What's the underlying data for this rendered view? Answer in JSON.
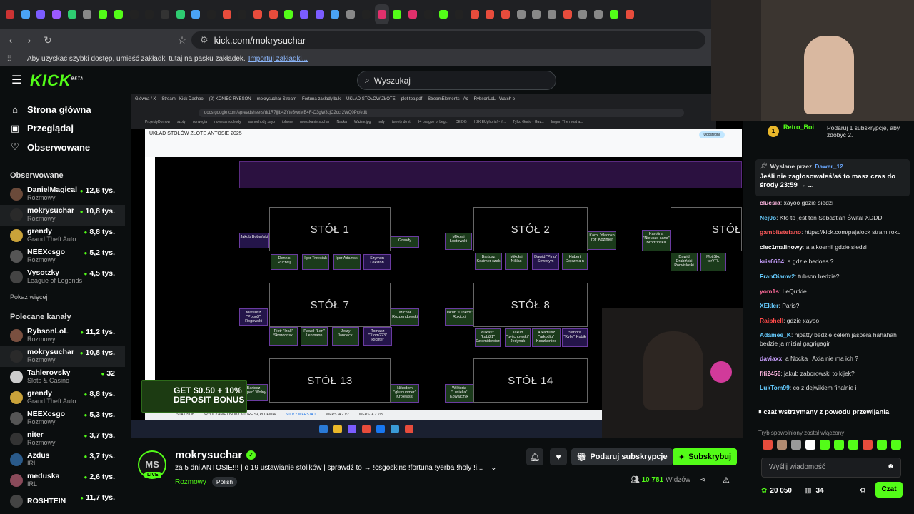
{
  "browser": {
    "url": "kick.com/mokrysuchar",
    "bookmarks_text": "Aby uzyskać szybki dostęp, umieść zakładki tutaj na pasku zakładek.",
    "bookmarks_link": "Importuj zakładki...",
    "tab_favicons": [
      "#c33",
      "#4aa3f5",
      "#7b5cff",
      "#9b59ff",
      "#2ecc71",
      "#888",
      "#53fc18",
      "#53fc18",
      "#222",
      "#222",
      "#333",
      "#2ecc71",
      "#4aa3f5",
      "#222",
      "#e74c3c",
      "#222",
      "#e74c3c",
      "#e74c3c",
      "#53fc18",
      "#7b5cff",
      "#7b5cff",
      "#4aa3f5",
      "#888",
      "#222",
      "#e1306c",
      "#53fc18",
      "#e1306c",
      "#222",
      "#53fc18",
      "#222",
      "#e74c3c",
      "#e74c3c",
      "#e74c3c",
      "#888",
      "#888",
      "#888",
      "#e74c3c",
      "#888",
      "#888",
      "#53fc18",
      "#e74c3c"
    ]
  },
  "header": {
    "logo": "KICK",
    "logo_badge": "BETA",
    "search_placeholder": "Wyszukaj"
  },
  "sidebar": {
    "nav": [
      {
        "icon": "⌂",
        "label": "Strona główna"
      },
      {
        "icon": "▣",
        "label": "Przeglądaj"
      },
      {
        "icon": "♡",
        "label": "Obserwowane"
      }
    ],
    "followed_title": "Obserwowane",
    "followed": [
      {
        "name": "DanielMagical",
        "category": "Rozmowy",
        "viewers": "12,6 tys.",
        "color": "#6a4a3a"
      },
      {
        "name": "mokrysuchar",
        "category": "Rozmowy",
        "viewers": "10,8 tys.",
        "color": "#2a2a2a"
      },
      {
        "name": "grendy",
        "category": "Grand Theft Auto ...",
        "viewers": "8,8 tys.",
        "color": "#c9a23a"
      },
      {
        "name": "NEEXcsgo",
        "category": "Rozmowy",
        "viewers": "5,2 tys.",
        "color": "#555"
      },
      {
        "name": "Vysotzky",
        "category": "League of Legends",
        "viewers": "4,5 tys.",
        "color": "#444"
      }
    ],
    "show_more": "Pokaż więcej",
    "recommended_title": "Polecane kanały",
    "recommended": [
      {
        "name": "RybsonLoL",
        "category": "Rozmowy",
        "viewers": "11,2 tys.",
        "color": "#7a5040"
      },
      {
        "name": "mokrysuchar",
        "category": "Rozmowy",
        "viewers": "10,8 tys.",
        "color": "#2a2a2a"
      },
      {
        "name": "Tahlerovsky",
        "category": "Slots & Casino",
        "viewers": "32",
        "color": "#ccc"
      },
      {
        "name": "grendy",
        "category": "Grand Theft Auto ...",
        "viewers": "8,8 tys.",
        "color": "#c9a23a"
      },
      {
        "name": "NEEXcsgo",
        "category": "Rozmowy",
        "viewers": "5,3 tys.",
        "color": "#555"
      },
      {
        "name": "niter",
        "category": "Rozmowy",
        "viewers": "3,7 tys.",
        "color": "#333"
      },
      {
        "name": "Azdus",
        "category": "IRL",
        "viewers": "3,7 tys.",
        "color": "#2a5a8a"
      },
      {
        "name": "meduska",
        "category": "IRL",
        "viewers": "2,6 tys.",
        "color": "#8a4a5a"
      },
      {
        "name": "ROSHTEIN",
        "category": "",
        "viewers": "11,7 tys.",
        "color": "#444"
      }
    ]
  },
  "player": {
    "inner_tabs": [
      "Główna / X",
      "Stream - Kick Dashbo",
      "(2) KONIEC RYBSON",
      "mokrysuchar Stream",
      "Fortuna zakłady buk",
      "UKŁAD STOŁÓW ZŁOTE",
      "plot top.pdf",
      "StreamElements - Ac",
      "RybsonLoL - Watch o"
    ],
    "inner_url": "docs.google.com/spreadsheets/d/1R7jjib42Yte3wxMB4F-O3gW3cjC2ccr2WQ0Pc/edit",
    "inner_bookmarks": [
      "ProjektyDomow",
      "szoty",
      "norwegia",
      "nowesamochody",
      "samochody xayo",
      "iphone",
      "mieszkanie suchar",
      "Nauka",
      "Ważne.jpg",
      "nufy",
      "tweety do rt",
      "94 League of Leg...",
      "CEIDG",
      "H2K EUphoria! - Y...",
      "Tylko Gucio - Gav...",
      "Imgur: The most a..."
    ],
    "sheet_title": "UKŁAD STOŁÓW ZŁOTE ANTOSIE 2025",
    "share_label": "Udostępnij",
    "tables": [
      {
        "label": "STÓŁ 1"
      },
      {
        "label": "STÓŁ 2"
      },
      {
        "label": "STÓŁ"
      },
      {
        "label": "STÓŁ 7"
      },
      {
        "label": "STÓŁ 8"
      },
      {
        "label": "STÓŁ 13"
      },
      {
        "label": "STÓŁ 14"
      }
    ],
    "names": [
      "Jakub Bobański",
      "Grendy",
      "Dennis Puchcij",
      "Igor Trzeciak",
      "Igor Adamski",
      "Szymon Lekston",
      "Mikołaj Łostowski",
      "Karol \"dlacoko rot\" Kozimer",
      "Bartosz Kozimer czak",
      "Mikołaj Niklas",
      "Dawid \"Piriu\" Sewerym",
      "Hubert Dojczma n",
      "Karolina \"Nieucze sana\" Brodzinska",
      "Dawid Drabiński Porwisloski",
      "MotiSko terYFL",
      "Mateusz \"Pogo3\" Rogowski",
      "Michał Rozpendowski",
      "Piotr \"Izak\" Skowronski",
      "Paweł \"Len\" Lehmann",
      "Jerzy Jandecki",
      "Tomasz \"Xtom223\" Richter",
      "Jakub \"Cinkrof\" Rokicki",
      "Łukasz \"kubi21\" Dziemidowicz",
      "Jakub \"twitchowski\" Jedynak",
      "Arkadiusz \"arkodiu\" Koczkoniec",
      "Sandra \"Kylie\" Kubik",
      "Bartosz \"Hyper\" Wolny",
      "Nikodem \"glutnunmer\" Królewski",
      "Wiktoria \"Lusiella\" Kowalczyk"
    ],
    "sheet_tabs": [
      "LISTA OSÓB",
      "WYLICZANIE OSOBY KTÓRE SĄ POJAWIA",
      "STOŁY WERSJA 1",
      "WERSJA 2 V2",
      "WERSJA 2 2/3"
    ],
    "deposit": "GET $0.50 + 10% DEPOSIT BONUS"
  },
  "stream": {
    "streamer_initials": "MS",
    "live": "LIVE",
    "streamer": "mokrysuchar",
    "title": "za 5 dni ANTOSIE!!! | o 19 ustawianie stolików | sprawdź to → !csgoskins !fortuna !yerba !holy !i...",
    "category": "Rozmowy",
    "tag": "Polish",
    "gift_subs": "Podaruj subskrypcje",
    "subscribe": "Subskrybuj",
    "viewers": "10 781",
    "viewers_label": "Widzów"
  },
  "chat": {
    "top_user": "Retro_Boi",
    "top_user_badge": "1",
    "gift_prompt": "Podaruj 1 subskrypcję, aby zdobyć 2.",
    "pinned_by": "Wysłane przez",
    "pinned_user": "Dawer_12",
    "pinned_text": "Jeśli nie zagłosowałeś/aś to masz czas do środy 23:59 → ...",
    "messages": [
      {
        "user": "cluesia",
        "color": "#ffb6e1",
        "text": "xayoo gdzie siedzi"
      },
      {
        "user": "Nej0o",
        "color": "#6cf",
        "text": "Kto to jest ten Sebastian Świtał XDDD"
      },
      {
        "user": "gambitstefano",
        "color": "#ff5a5a",
        "text": "https://kick.com/pajalock stram roku"
      },
      {
        "user": "ciec1malinowy",
        "color": "#fff",
        "text": "a aikoemil gdzie siedzi"
      },
      {
        "user": "kris6664",
        "color": "#c9a0ff",
        "text": "a gdzie bedoes ?"
      },
      {
        "user": "FranOiamv2",
        "color": "#6cf",
        "text": "tubson bedzie?"
      },
      {
        "user": "yom1s",
        "color": "#ff6b9a",
        "text": "LeQutkie"
      },
      {
        "user": "XEkler",
        "color": "#6cf",
        "text": "Paris?"
      },
      {
        "user": "Raiphell",
        "color": "#ff4a4a",
        "text": "gdzie xayoo"
      },
      {
        "user": "Adamee_K",
        "color": "#6cf",
        "text": "hipatty bedzie celem jaspera hahahah bedzie ja miział gagrigagir"
      },
      {
        "user": "daviaxx",
        "color": "#c9a0ff",
        "text": "a Nocka i Axia nie ma ich ?"
      },
      {
        "user": "fifi2456",
        "color": "#ffb6e1",
        "text": "jakub zaborowski to kijek?"
      },
      {
        "user": "LukTom99",
        "color": "#6cf",
        "text": "co z dejwikiem finalnie i"
      }
    ],
    "paused": "czat wstrzymany z powodu przewijania",
    "slow_mode": "Tryb spowolniony został włączony",
    "input_placeholder": "Wyślij wiadomość",
    "points": "20 050",
    "gifts": "34",
    "send": "Czat"
  }
}
